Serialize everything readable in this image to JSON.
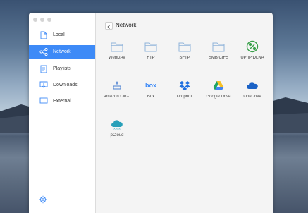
{
  "sidebar": {
    "items": [
      {
        "label": "Local",
        "icon": "file-icon"
      },
      {
        "label": "Network",
        "icon": "network-share-icon"
      },
      {
        "label": "Playlists",
        "icon": "playlist-icon"
      },
      {
        "label": "Downloads",
        "icon": "download-icon"
      },
      {
        "label": "External",
        "icon": "external-drive-icon"
      }
    ],
    "active": "Network",
    "settings_icon": "gear-icon"
  },
  "main": {
    "title": "Network",
    "back_icon": "chevron-left-icon",
    "services": [
      {
        "label": "WebDAV",
        "icon": "folder-icon"
      },
      {
        "label": "FTP",
        "icon": "folder-icon"
      },
      {
        "label": "SFTP",
        "icon": "folder-icon"
      },
      {
        "label": "SMB/CIFS",
        "icon": "folder-icon"
      },
      {
        "label": "UPnP/DLNA",
        "icon": "upnp-icon"
      },
      {
        "label": "Amazon Clo···",
        "icon": "amazon-cloud-icon"
      },
      {
        "label": "Box",
        "icon": "box-icon"
      },
      {
        "label": "Dropbox",
        "icon": "dropbox-icon"
      },
      {
        "label": "Google Drive",
        "icon": "google-drive-icon"
      },
      {
        "label": "OneDrive",
        "icon": "onedrive-icon"
      },
      {
        "label": "pCloud",
        "icon": "pcloud-icon"
      }
    ]
  },
  "colors": {
    "accent": "#3d8af7",
    "folder": "#8fb3da",
    "upnp": "#3aa04a",
    "box": "#3d8af7",
    "dropbox": "#1f6fe0",
    "onedrive": "#1b62c6",
    "pcloud": "#27a0b9"
  }
}
